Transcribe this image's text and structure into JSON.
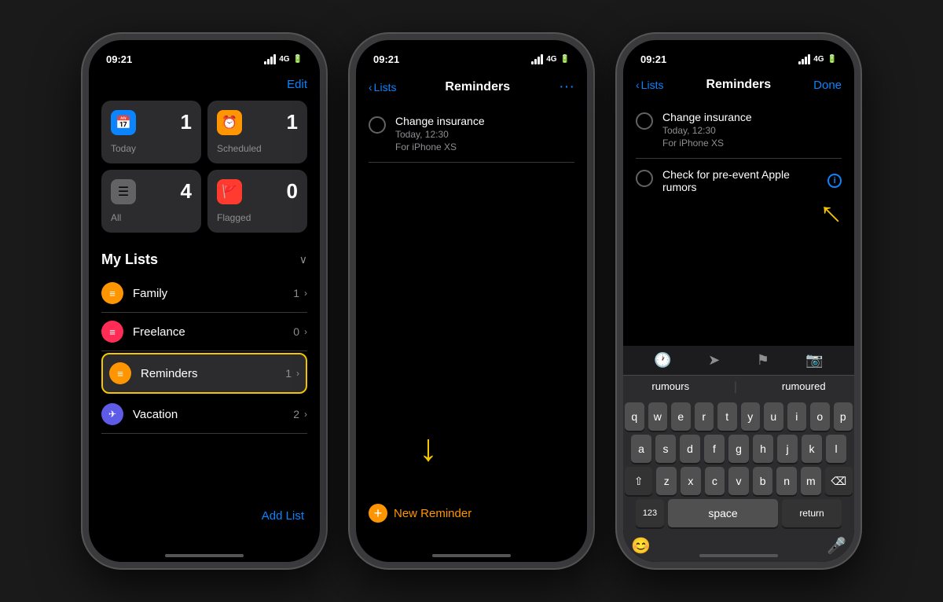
{
  "phone1": {
    "status_time": "09:21",
    "signal": "4G",
    "nav_button": "Edit",
    "cards": [
      {
        "label": "Today",
        "count": "1",
        "icon": "📅",
        "icon_class": "icon-blue"
      },
      {
        "label": "Scheduled",
        "count": "1",
        "icon": "⏰",
        "icon_class": "icon-orange"
      },
      {
        "label": "All",
        "count": "4",
        "icon": "📋",
        "icon_class": "icon-gray"
      },
      {
        "label": "Flagged",
        "count": "0",
        "icon": "🚩",
        "icon_class": "icon-red"
      }
    ],
    "section_title": "My Lists",
    "lists": [
      {
        "name": "Family",
        "count": "1",
        "icon": "≡",
        "icon_bg": "#ff9500",
        "selected": false
      },
      {
        "name": "Freelance",
        "count": "0",
        "icon": "≡",
        "icon_bg": "#ff2d55",
        "selected": false
      },
      {
        "name": "Reminders",
        "count": "1",
        "icon": "≡",
        "icon_bg": "#ff9500",
        "selected": true
      },
      {
        "name": "Vacation",
        "count": "2",
        "icon": "✈",
        "icon_bg": "#5e5ce6",
        "selected": false
      }
    ],
    "add_list": "Add List"
  },
  "phone2": {
    "status_time": "09:21",
    "nav_back": "Lists",
    "nav_title": "Reminders",
    "reminders": [
      {
        "title": "Change insurance",
        "sub1": "Today, 12:30",
        "sub2": "For iPhone XS"
      }
    ],
    "new_reminder": "New Reminder",
    "arrow_label": "↓"
  },
  "phone3": {
    "status_time": "09:21",
    "nav_back": "Lists",
    "nav_title": "Reminders",
    "nav_done": "Done",
    "reminders": [
      {
        "title": "Change insurance",
        "sub1": "Today, 12:30",
        "sub2": "For iPhone XS"
      },
      {
        "title": "Check for pre-event Apple rumors",
        "sub1": "",
        "sub2": ""
      }
    ],
    "suggestions": [
      "rumours",
      "rumoured"
    ],
    "keyboard_rows": [
      [
        "q",
        "w",
        "e",
        "r",
        "t",
        "y",
        "u",
        "i",
        "o",
        "p"
      ],
      [
        "a",
        "s",
        "d",
        "f",
        "g",
        "h",
        "j",
        "k",
        "l"
      ],
      [
        "z",
        "x",
        "c",
        "v",
        "b",
        "n",
        "m"
      ],
      [
        "123",
        "space",
        "return"
      ]
    ]
  }
}
